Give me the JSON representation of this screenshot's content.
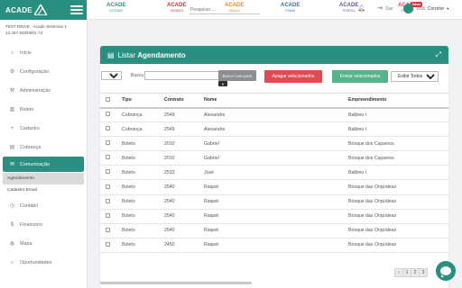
{
  "colors": {
    "primary": "#2a8f80",
    "danger": "#e04a52",
    "success": "#56b38a",
    "grey_button": "#8a8f94"
  },
  "sidebar": {
    "logo": "ACADE",
    "company_line1": "TEST DRIVE - Acade Sistemas 1",
    "company_line2": "13.457.933/0001-73",
    "items": [
      {
        "label": "Início",
        "icon": "home-icon",
        "glyph": "⌂"
      },
      {
        "label": "Configuração",
        "icon": "gear-icon",
        "glyph": "⚙"
      },
      {
        "label": "Administração",
        "icon": "admin-icon",
        "glyph": "⚒"
      },
      {
        "label": "Boleto",
        "icon": "barcode-icon",
        "glyph": "▥"
      },
      {
        "label": "Cadastro",
        "icon": "plus-icon",
        "glyph": "+"
      },
      {
        "label": "Cobrança",
        "icon": "billing-icon",
        "glyph": "▤"
      },
      {
        "label": "Comunicação",
        "icon": "message-icon",
        "glyph": "✉"
      },
      {
        "label": "Contábil",
        "icon": "accounting-icon",
        "glyph": "◷"
      },
      {
        "label": "Financeiro",
        "icon": "dollar-icon",
        "glyph": "$"
      },
      {
        "label": "Mapa",
        "icon": "globe-icon",
        "glyph": "◍"
      },
      {
        "label": "Oportunidades",
        "icon": "bulb-icon",
        "glyph": "☼"
      }
    ],
    "submenu": [
      "Agendamento",
      "Cadastro Email"
    ]
  },
  "topbar": {
    "brands": [
      {
        "name": "ACADE",
        "sub": "LOTEAR"
      },
      {
        "name": "ACADE",
        "sub": "VENDAS"
      },
      {
        "name": "ACADE",
        "sub": "OBRAS"
      },
      {
        "name": "ACADE",
        "sub": "FINAN"
      },
      {
        "name": "ACADE",
        "sub": "PORTAL"
      },
      {
        "name": "ACADE",
        "sub": "EXPERT",
        "badge": "News"
      }
    ],
    "search_placeholder": "Pesquisar ...",
    "logout_label": "Sair",
    "user_prefix": "João",
    "user_name": "Corretor"
  },
  "card": {
    "title_prefix": "Listar",
    "title_bold": "Agendamento",
    "per_page": "10",
    "busca_label": "Busca",
    "btn_avancada": "Busca Avançada",
    "btn_clear": "✕",
    "btn_apagar": "Apagar selecionados",
    "btn_enviar": "Enviar selecionados",
    "exibir": "Exibir Todos",
    "columns": [
      "Tipo",
      "Contrato",
      "Nome",
      "Empreendimento"
    ],
    "rows": [
      [
        "Cobrança",
        "2549",
        "Alexandre",
        "Balbino I"
      ],
      [
        "Cobrança",
        "2549",
        "Alexandre",
        "Balbino I"
      ],
      [
        "Boleto",
        "2010",
        "Gabriel",
        "Bosque dos Cajueiros"
      ],
      [
        "Boleto",
        "2010",
        "Gabriel",
        "Bosque dos Cajueiros"
      ],
      [
        "Boleto",
        "2533",
        "José",
        "Balbino I"
      ],
      [
        "Boleto",
        "2540",
        "Raquel",
        "Bosque das Orquídeas"
      ],
      [
        "Boleto",
        "2540",
        "Raquel",
        "Bosque das Orquídeas"
      ],
      [
        "Boleto",
        "2540",
        "Raquel",
        "Bosque das Orquídeas"
      ],
      [
        "Boleto",
        "2540",
        "Raquel",
        "Bosque das Orquídeas"
      ],
      [
        "Boleto",
        "2450",
        "Raquel",
        "Bosque das Orquídeas"
      ]
    ],
    "pagination": [
      "‹",
      "1",
      "2",
      "3"
    ]
  }
}
